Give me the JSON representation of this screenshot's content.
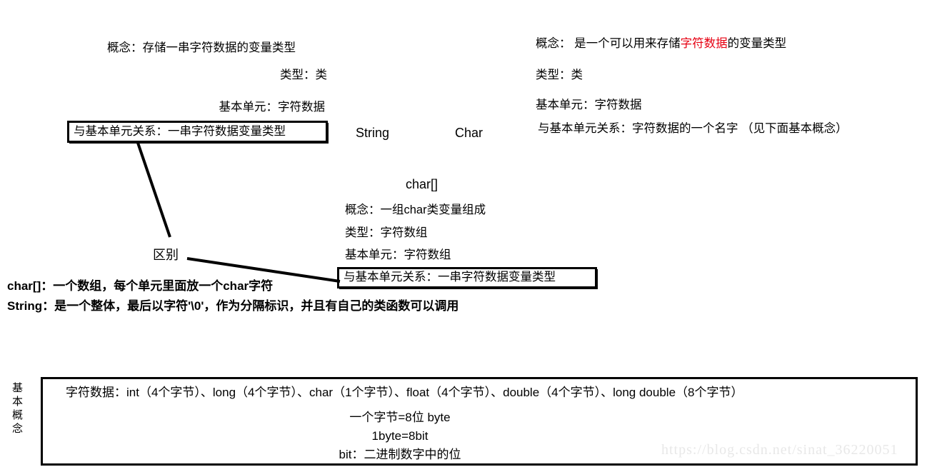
{
  "diagram": {
    "title_nodes": {
      "string": "String",
      "char": "Char",
      "char_array": "char[]",
      "difference": "区别"
    },
    "string_block": {
      "concept": "概念：存储一串字符数据的变量类型",
      "type": "类型：类",
      "basic_unit": "基本单元：字符数据",
      "relation_box": "与基本单元关系：一串字符数据变量类型"
    },
    "char_block": {
      "concept_prefix": "概念： 是一个可以用来存储",
      "concept_highlight": "字符数据",
      "concept_suffix": "的变量类型",
      "type": "类型：类",
      "basic_unit": "基本单元：字符数据",
      "relation": "与基本单元关系：字符数据的一个名字 （见下面基本概念）"
    },
    "char_array_block": {
      "concept": "概念：一组char类变量组成",
      "type": "类型：字符数组",
      "basic_unit": "基本单元：字符数组",
      "relation_box": "与基本单元关系：一串字符数据变量类型"
    },
    "difference_notes": {
      "line1": "char[]：一个数组，每个单元里面放一个char字符",
      "line2": "String：是一个整体，最后以字符'\\0'，作为分隔标识，并且有自己的类函数可以调用"
    },
    "basic_concept": {
      "side_label": "基本概念",
      "side_label_color": "#e60012",
      "line1": "字符数据：int（4个字节）、long（4个字节）、char（1个字节）、float（4个字节）、double（4个字节）、long double（8个字节）",
      "line2": "一个字节=8位 byte",
      "line3": "1byte=8bit",
      "line4": "bit：二进制数字中的位"
    },
    "watermark": "https://blog.csdn.net/sinat_36220051"
  }
}
